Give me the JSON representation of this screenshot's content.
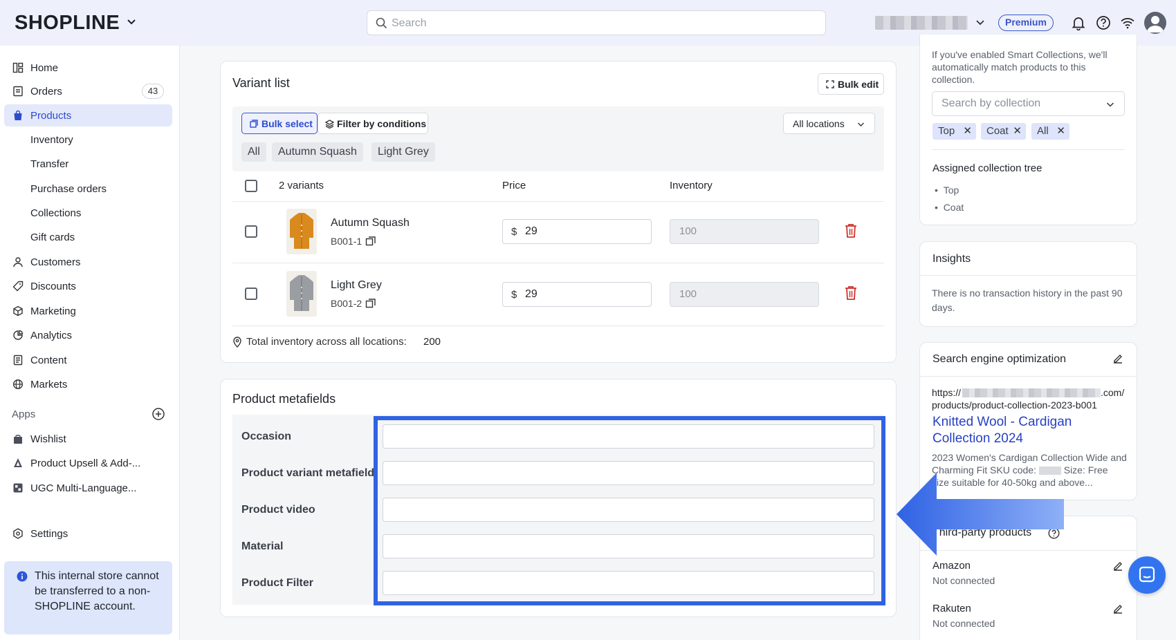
{
  "topbar": {
    "logo": "SHOPLINE",
    "search_placeholder": "Search",
    "plan_badge": "Premium"
  },
  "sidebar": {
    "items": [
      {
        "label": "Home"
      },
      {
        "label": "Orders",
        "badge": "43"
      },
      {
        "label": "Products"
      },
      {
        "label": "Inventory"
      },
      {
        "label": "Transfer"
      },
      {
        "label": "Purchase orders"
      },
      {
        "label": "Collections"
      },
      {
        "label": "Gift cards"
      },
      {
        "label": "Customers"
      },
      {
        "label": "Discounts"
      },
      {
        "label": "Marketing"
      },
      {
        "label": "Analytics"
      },
      {
        "label": "Content"
      },
      {
        "label": "Markets"
      }
    ],
    "apps_label": "Apps",
    "apps": [
      {
        "label": "Wishlist"
      },
      {
        "label": "Product Upsell & Add-..."
      },
      {
        "label": "UGC Multi-Language..."
      }
    ],
    "settings_label": "Settings",
    "notice": "This internal store cannot be transferred to a non-SHOPLINE account."
  },
  "variant_list": {
    "title": "Variant list",
    "bulk_edit_label": "Bulk edit",
    "bulk_select_label": "Bulk select",
    "filter_label": "Filter by conditions",
    "location_select": "All locations",
    "chips": [
      "All",
      "Autumn Squash",
      "Light Grey"
    ],
    "header": {
      "variants": "2 variants",
      "price": "Price",
      "inventory": "Inventory"
    },
    "rows": [
      {
        "name": "Autumn Squash",
        "sku": "B001-1",
        "currency": "$",
        "price": "29",
        "inventory": "100",
        "color": "#d98a1f"
      },
      {
        "name": "Light Grey",
        "sku": "B001-2",
        "currency": "$",
        "price": "29",
        "inventory": "100",
        "color": "#9a9ea3"
      }
    ],
    "total_label": "Total inventory across all locations:",
    "total_value": "200"
  },
  "metafields": {
    "title": "Product metafields",
    "fields": [
      {
        "label": "Occasion",
        "value": ""
      },
      {
        "label": "Product variant metafield",
        "value": ""
      },
      {
        "label": "Product video",
        "value": ""
      },
      {
        "label": "Material",
        "value": ""
      },
      {
        "label": "Product Filter",
        "value": ""
      }
    ]
  },
  "collections_panel": {
    "smart_note": "If you've enabled Smart Collections, we'll automatically match products to this collection.",
    "search_placeholder": "Search by collection",
    "tags": [
      "Top",
      "Coat",
      "All"
    ],
    "tree_title": "Assigned collection tree",
    "tree_items": [
      "Top",
      "Coat"
    ]
  },
  "insights": {
    "title": "Insights",
    "text": "There is no transaction history in the past 90 days."
  },
  "seo": {
    "title": "Search engine optimization",
    "url_prefix": "https://",
    "url_suffix": ".com/",
    "url_path": "products/product-collection-2023-b001",
    "page_title": "Knitted Wool - Cardigan Collection 2024",
    "desc_start": "2023 Women's Cardigan Collection Wide and Charming Fit SKU code:",
    "desc_end": "Size: Free size suitable for 40-50kg and above..."
  },
  "third_party": {
    "title": "Third-party products",
    "items": [
      {
        "name": "Amazon",
        "status": "Not connected"
      },
      {
        "name": "Rakuten",
        "status": "Not connected"
      }
    ]
  },
  "colors": {
    "accent": "#2d4bd0",
    "highlight": "#2f62e4",
    "danger": "#d0312d"
  }
}
